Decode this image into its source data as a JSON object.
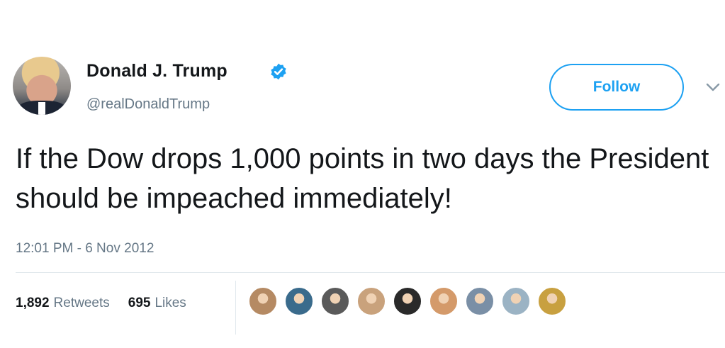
{
  "user": {
    "name": "Donald J. Trump",
    "handle": "@realDonaldTrump",
    "verified_icon": "verified-badge-icon",
    "avatar_icon": "profile-photo"
  },
  "follow_button": {
    "label": "Follow"
  },
  "menu": {
    "icon": "chevron-down-icon"
  },
  "tweet": {
    "text": "If the Dow drops 1,000 points in two days the President should be impeached immediately!",
    "timestamp": "12:01 PM - 6 Nov 2012"
  },
  "stats": {
    "retweets_count": "1,892",
    "retweets_label": "Retweets",
    "likes_count": "695",
    "likes_label": "Likes"
  },
  "likers": [
    {
      "icon": "liker-avatar-1",
      "color": "#b58a63"
    },
    {
      "icon": "liker-avatar-2",
      "color": "#3a6b8c"
    },
    {
      "icon": "liker-avatar-3",
      "color": "#5a5a5a"
    },
    {
      "icon": "liker-avatar-4",
      "color": "#c9a27c"
    },
    {
      "icon": "liker-avatar-5",
      "color": "#2a2a2a"
    },
    {
      "icon": "liker-avatar-6",
      "color": "#d49a6a"
    },
    {
      "icon": "liker-avatar-7",
      "color": "#7a8fa6"
    },
    {
      "icon": "liker-avatar-8",
      "color": "#9bb3c4"
    },
    {
      "icon": "liker-avatar-9",
      "color": "#c8a040"
    }
  ],
  "colors": {
    "accent": "#1da1f2",
    "text": "#14171a",
    "muted": "#657786"
  }
}
